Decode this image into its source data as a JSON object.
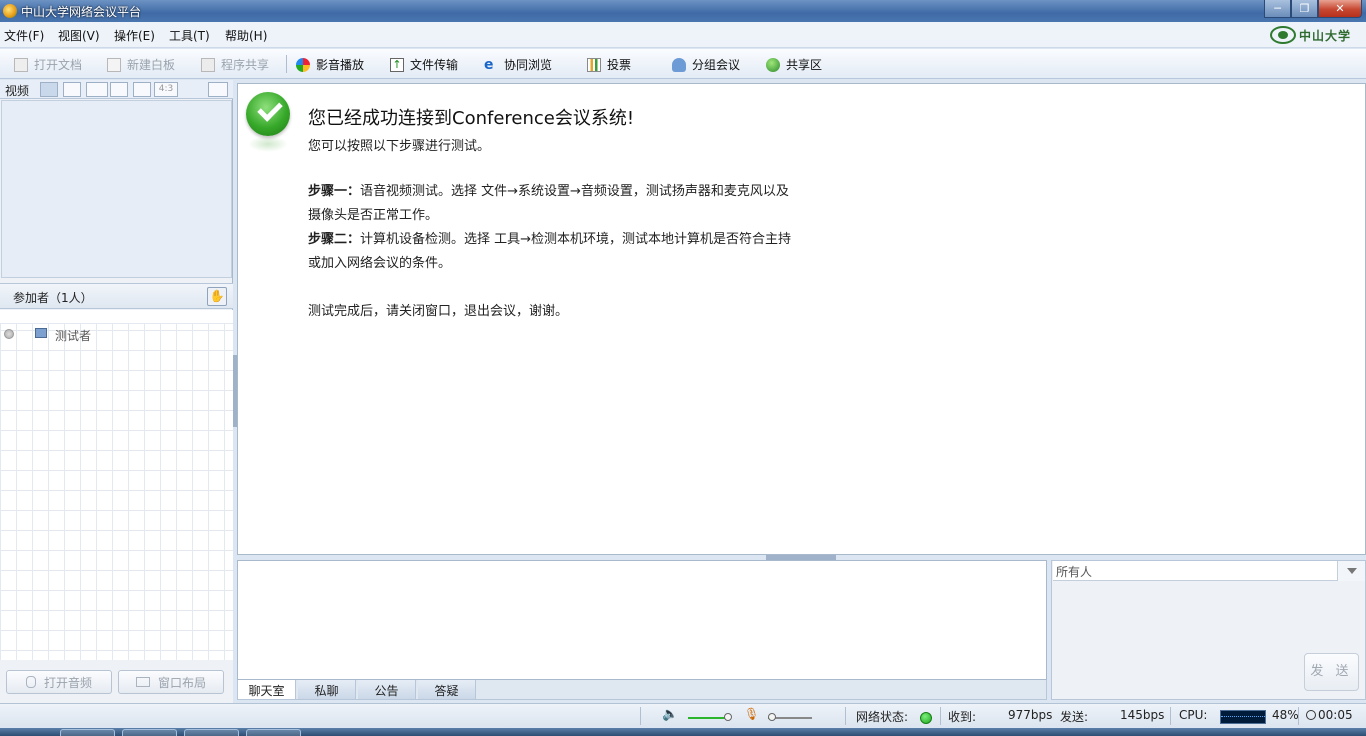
{
  "window": {
    "title": "中山大学网络会议平台"
  },
  "window_buttons": [
    "─",
    "❐",
    "✕"
  ],
  "menu": [
    "文件(F)",
    "视图(V)",
    "操作(E)",
    "工具(T)",
    "帮助(H)"
  ],
  "logo": {
    "text": "中山大学"
  },
  "toolbar": [
    {
      "label": "打开文档",
      "icon": "folder-open-icon",
      "enabled": false
    },
    {
      "label": "新建白板",
      "icon": "whiteboard-icon",
      "enabled": false
    },
    {
      "label": "程序共享",
      "icon": "app-share-icon",
      "enabled": false
    },
    {
      "label": "影音播放",
      "icon": "media-play-icon",
      "enabled": true
    },
    {
      "label": "文件传输",
      "icon": "file-transfer-icon",
      "enabled": true
    },
    {
      "label": "协同浏览",
      "icon": "browser-icon",
      "enabled": true
    },
    {
      "label": "投票",
      "icon": "vote-chart-icon",
      "enabled": true
    },
    {
      "label": "分组会议",
      "icon": "group-users-icon",
      "enabled": true
    },
    {
      "label": "共享区",
      "icon": "globe-icon",
      "enabled": true
    }
  ],
  "video": {
    "label": "视频",
    "ratio_label": "4:3"
  },
  "participants": {
    "header": "参加者（1人）",
    "hand_icon": "✋",
    "list": [
      {
        "name": "测试者"
      }
    ]
  },
  "left_buttons": {
    "open_audio": "打开音频",
    "window_layout": "窗口布局"
  },
  "welcome": {
    "title": "您已经成功连接到Conference会议系统!",
    "subtitle": "您可以按照以下步骤进行测试。",
    "step1_label": "步骤一：",
    "step1_line1": "语音视频测试。选择 文件→系统设置→音频设置，测试扬声器和麦克风以及",
    "step1_line2": "摄像头是否正常工作。",
    "step2_label": "步骤二：",
    "step2_line1": "计算机设备检测。选择 工具→检测本机环境，测试本地计算机是否符合主持",
    "step2_line2": "或加入网络会议的条件。",
    "closing": "测试完成后，请关闭窗口，退出会议，谢谢。"
  },
  "chat_tabs": [
    "聊天室",
    "私聊",
    "公告",
    "答疑"
  ],
  "recipient": {
    "selected": "所有人"
  },
  "send_label": "发 送",
  "status": {
    "network_label": "网络状态:",
    "recv_label": "收到:",
    "recv_value": "977bps",
    "send_label": "发送:",
    "send_value": "145bps",
    "cpu_label": "CPU:",
    "cpu_value": "48%",
    "time": "00:05",
    "speaker_level": 0.95,
    "mic_level": 0.05
  },
  "colors": {
    "accent": "#3f6aa6",
    "ok_green": "#36a829"
  }
}
